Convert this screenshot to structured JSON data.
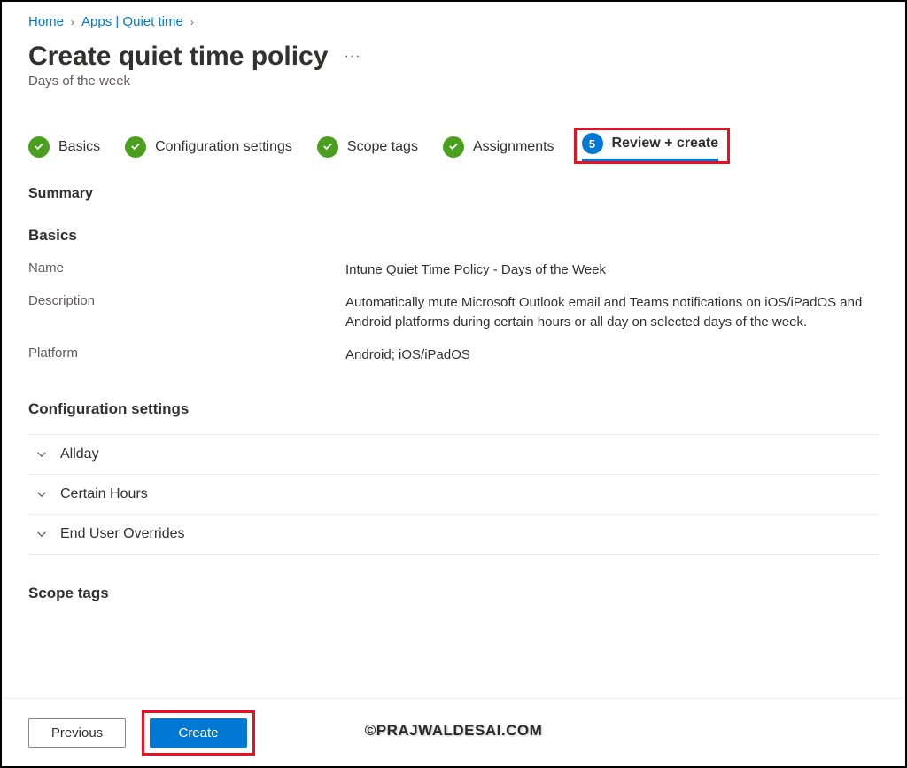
{
  "breadcrumb": {
    "home": "Home",
    "apps": "Apps | Quiet time"
  },
  "header": {
    "title": "Create quiet time policy",
    "subtitle": "Days of the week"
  },
  "wizard": {
    "steps": [
      {
        "label": "Basics"
      },
      {
        "label": "Configuration settings"
      },
      {
        "label": "Scope tags"
      },
      {
        "label": "Assignments"
      }
    ],
    "active_step_number": "5",
    "active_step_label": "Review + create"
  },
  "summary": {
    "title": "Summary",
    "basics": {
      "heading": "Basics",
      "name_label": "Name",
      "name_value": "Intune Quiet Time Policy - Days of the Week",
      "description_label": "Description",
      "description_value": "Automatically mute Microsoft Outlook email and Teams notifications on iOS/iPadOS and Android platforms during certain hours or all day on selected days of the week.",
      "platform_label": "Platform",
      "platform_value": "Android; iOS/iPadOS"
    },
    "config": {
      "heading": "Configuration settings",
      "items": [
        {
          "label": "Allday"
        },
        {
          "label": "Certain Hours"
        },
        {
          "label": "End User Overrides"
        }
      ]
    },
    "scope_heading": "Scope tags"
  },
  "footer": {
    "previous": "Previous",
    "create": "Create"
  },
  "watermark": "©PRAJWALDESAI.COM"
}
